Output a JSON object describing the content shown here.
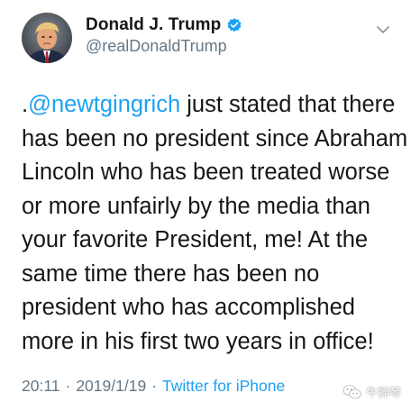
{
  "user": {
    "display_name": "Donald J. Trump",
    "handle": "@realDonaldTrump",
    "verified_color": "#1da1f2"
  },
  "tweet": {
    "lines": [
      {
        "prefix": ".",
        "mention": "@newtgingrich",
        "text": " just stated that there"
      },
      {
        "text": "has been no president since Abraham"
      },
      {
        "text": "Lincoln who has been treated worse"
      },
      {
        "text": "or more unfairly by the media than"
      },
      {
        "text": "your favorite President, me! At the"
      },
      {
        "text": "same time there has been no"
      },
      {
        "text": "president who has accomplished"
      },
      {
        "text": "more in his first two years in office!"
      }
    ]
  },
  "meta": {
    "time": "20:11",
    "separator": "·",
    "date": "2019/1/19",
    "source": "Twitter for iPhone"
  },
  "watermark": {
    "text": "牛弹琴"
  },
  "icons": {
    "verified": "verified-badge-icon",
    "menu": "chevron-down-icon",
    "watermark": "wechat-icon"
  },
  "colors": {
    "link": "#1da1f2",
    "secondary": "#657786",
    "text": "#14171a"
  }
}
